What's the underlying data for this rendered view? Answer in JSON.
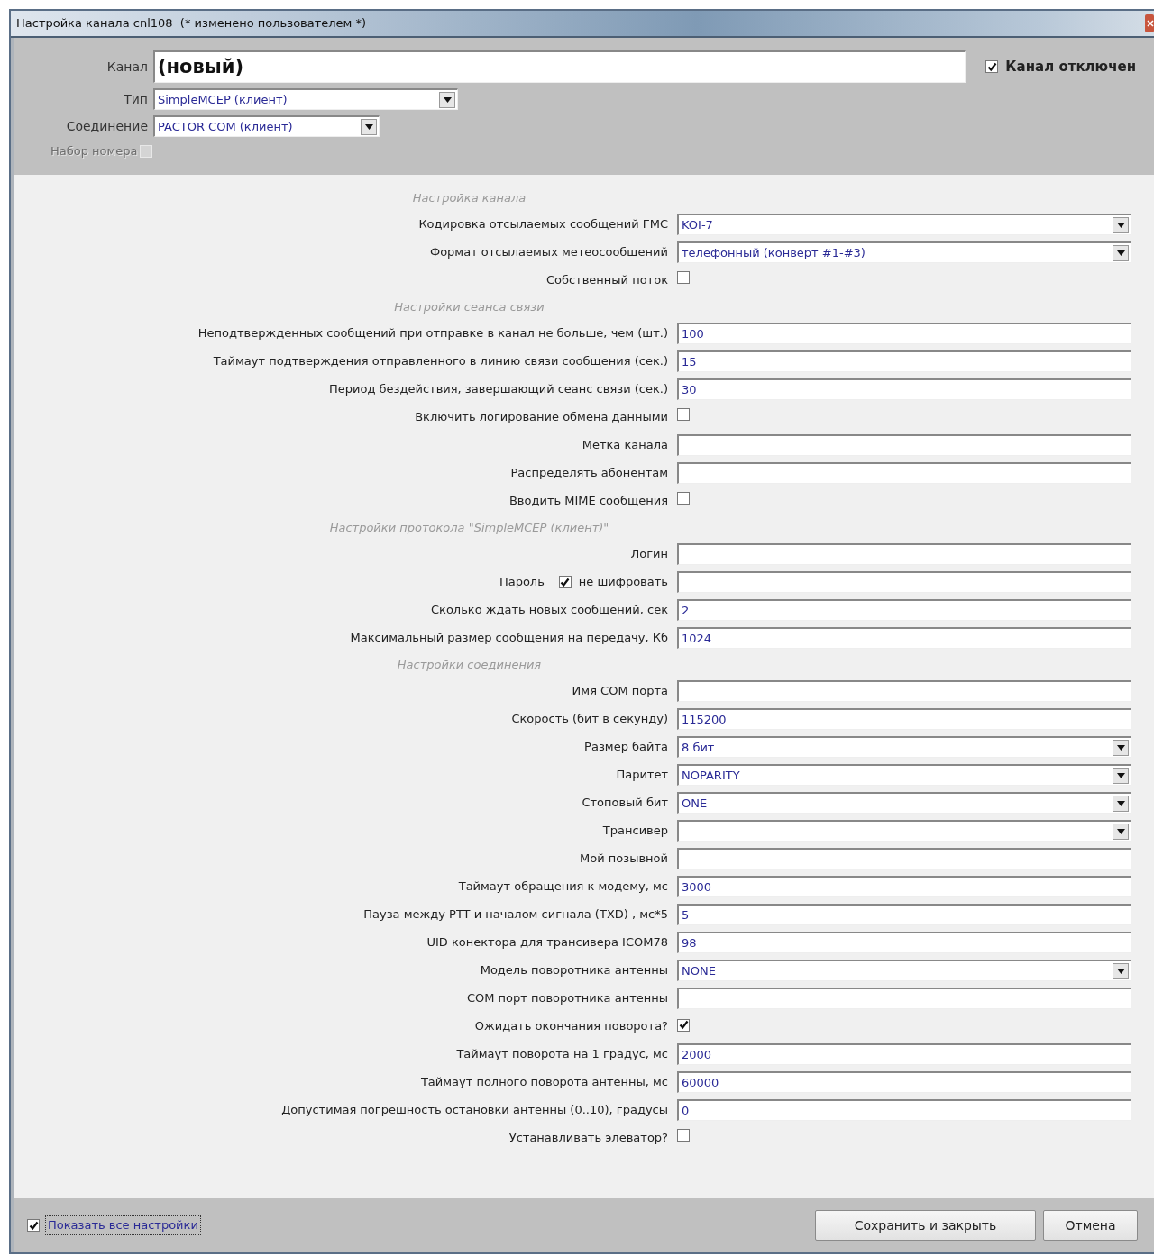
{
  "window": {
    "title": "Настройка канала cnl108  (* изменено пользователем *)"
  },
  "header": {
    "channel": {
      "label": "Канал",
      "value": "(новый)"
    },
    "channel_disabled": {
      "label": "Канал отключен",
      "checked": true
    },
    "type": {
      "label": "Тип",
      "value": "SimpleMCEP (клиент)"
    },
    "connection": {
      "label": "Соединение",
      "value": "PACTOR COM (клиент)"
    },
    "dialing": {
      "label": "Набор номера",
      "checked": false,
      "disabled": true
    }
  },
  "settings": [
    {
      "kind": "section",
      "label": "Настройка канала"
    },
    {
      "kind": "select",
      "label": "Кодировка отсылаемых сообщений ГМС",
      "value": "KOI-7"
    },
    {
      "kind": "select",
      "label": "Формат отсылаемых метеосообщений",
      "value": "телефонный (конверт #1-#3)"
    },
    {
      "kind": "checkbox",
      "label": "Собственный поток",
      "checked": false
    },
    {
      "kind": "section",
      "label": "Настройки сеанса связи"
    },
    {
      "kind": "text",
      "label": "Неподтвержденных сообщений при отправке в канал не больше, чем (шт.)",
      "value": "100"
    },
    {
      "kind": "text",
      "label": "Таймаут подтверждения отправленного в линию связи сообщения (сек.)",
      "value": "15"
    },
    {
      "kind": "text",
      "label": "Период бездействия, завершающий сеанс связи (сек.)",
      "value": "30"
    },
    {
      "kind": "checkbox",
      "label": "Включить логирование обмена данными",
      "checked": false
    },
    {
      "kind": "text",
      "label": "Метка канала"
    },
    {
      "kind": "text",
      "label": "Распределять абонентам"
    },
    {
      "kind": "checkbox",
      "label": "Вводить MIME сообщения",
      "checked": false
    },
    {
      "kind": "section",
      "label": "Настройки протокола \"SimpleMCEP (клиент)\""
    },
    {
      "kind": "text",
      "label": "Логин"
    },
    {
      "kind": "password",
      "label": "Пароль",
      "option_label": "не шифровать",
      "option_checked": true
    },
    {
      "kind": "text",
      "label": "Сколько ждать новых сообщений, сек",
      "value": "2"
    },
    {
      "kind": "text",
      "label": "Максимальный размер сообщения на передачу, Кб",
      "value": "1024"
    },
    {
      "kind": "section",
      "label": "Настройки соединения"
    },
    {
      "kind": "text",
      "label": "Имя COM порта"
    },
    {
      "kind": "text",
      "label": "Скорость (бит в секунду)",
      "value": "115200"
    },
    {
      "kind": "select",
      "label": "Размер байта",
      "value": "8 бит"
    },
    {
      "kind": "select",
      "label": "Паритет",
      "value": "NOPARITY"
    },
    {
      "kind": "select",
      "label": "Стоповый бит",
      "value": "ONE"
    },
    {
      "kind": "select",
      "label": "Трансивер"
    },
    {
      "kind": "text",
      "label": "Мой позывной"
    },
    {
      "kind": "text",
      "label": "Таймаут обращения к модему, мс",
      "value": "3000"
    },
    {
      "kind": "text",
      "label": "Пауза между PTT и началом сигнала (TXD) , мс*5",
      "value": "5"
    },
    {
      "kind": "text",
      "label": "UID конектора для трансивера ICOM78",
      "value": "98"
    },
    {
      "kind": "select",
      "label": "Модель поворотника антенны",
      "value": "NONE"
    },
    {
      "kind": "text",
      "label": "COM порт поворотника антенны"
    },
    {
      "kind": "checkbox",
      "label": "Ожидать окончания поворота?",
      "checked": true
    },
    {
      "kind": "text",
      "label": "Таймаут поворота на 1 градус, мс",
      "value": "2000"
    },
    {
      "kind": "text",
      "label": "Таймаут полного поворота антенны, мс",
      "value": "60000"
    },
    {
      "kind": "text",
      "label": "Допустимая погрешность остановки антенны (0..10), градусы",
      "value": "0"
    },
    {
      "kind": "checkbox",
      "label": "Устанавливать элеватор?",
      "checked": false
    }
  ],
  "footer": {
    "show_all": {
      "label": "Показать все настройки",
      "checked": true
    },
    "buttons": [
      "Сохранить и закрыть",
      "Отмена"
    ]
  }
}
